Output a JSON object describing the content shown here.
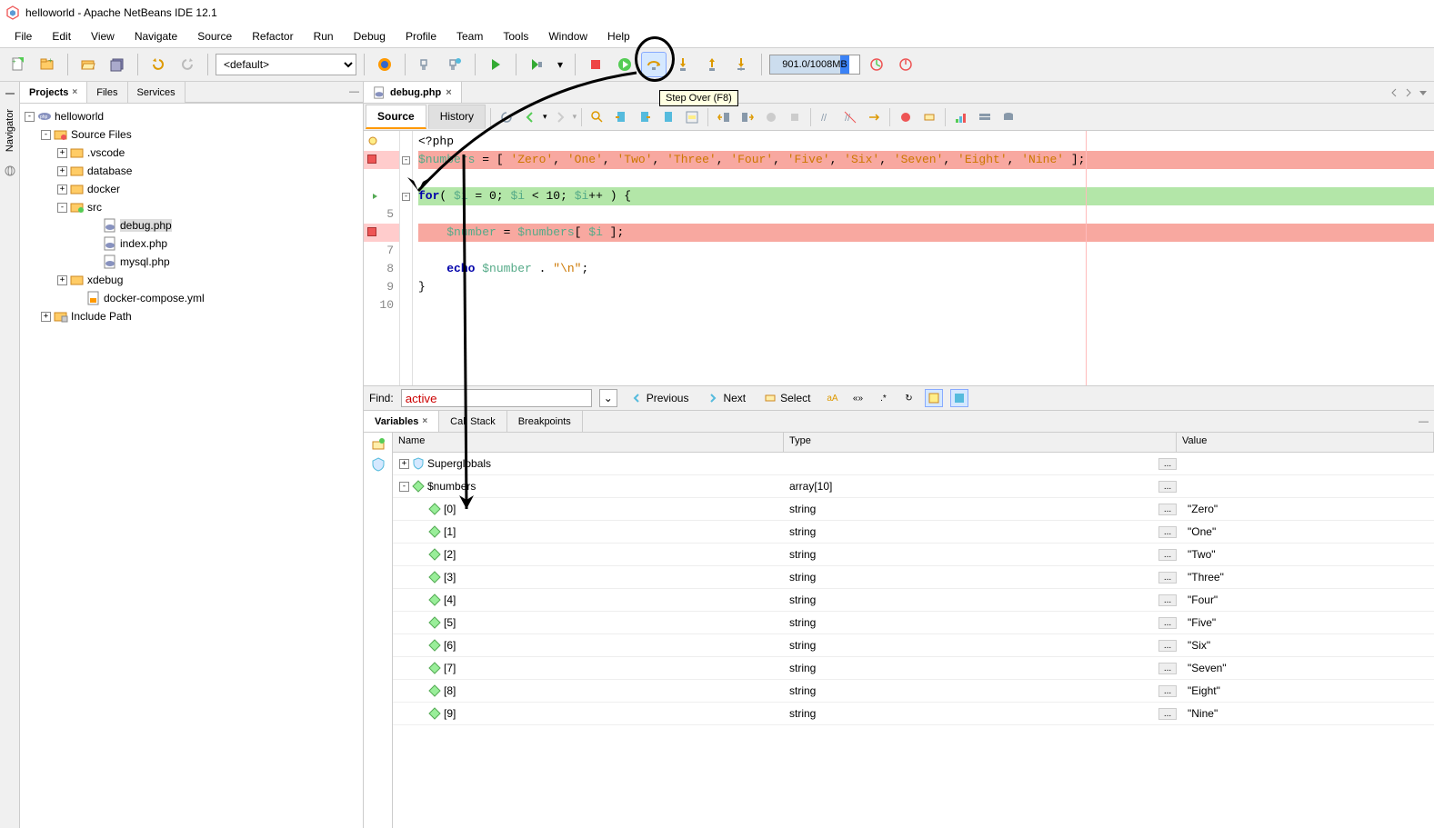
{
  "window": {
    "title": "helloworld - Apache NetBeans IDE 12.1"
  },
  "menu": [
    "File",
    "Edit",
    "View",
    "Navigate",
    "Source",
    "Refactor",
    "Run",
    "Debug",
    "Profile",
    "Team",
    "Tools",
    "Window",
    "Help"
  ],
  "toolbar": {
    "config_select": "<default>",
    "memory": "901.0/1008MB",
    "tooltip": "Step Over (F8)"
  },
  "side_tab": {
    "label": "Navigator"
  },
  "left_panel": {
    "tabs": {
      "projects": "Projects",
      "files": "Files",
      "services": "Services"
    },
    "tree": {
      "root": "helloworld",
      "source_files": "Source Files",
      "vscode": ".vscode",
      "database": "database",
      "docker": "docker",
      "src": "src",
      "debug_php": "debug.php",
      "index_php": "index.php",
      "mysql_php": "mysql.php",
      "xdebug": "xdebug",
      "docker_compose": "docker-compose.yml",
      "include_path": "Include Path"
    }
  },
  "editor": {
    "tab_label": "debug.php",
    "subtabs": {
      "source": "Source",
      "history": "History"
    },
    "code": {
      "l1": "<?php",
      "l2": "$numbers = [ 'Zero', 'One', 'Two', 'Three', 'Four', 'Five', 'Six', 'Seven', 'Eight', 'Nine' ];",
      "l4a": "for( ",
      "l4b": "$i",
      "l4c": " = ",
      "l4d": "0",
      "l4e": "; ",
      "l4f": "$i",
      "l4g": " < ",
      "l4h": "10",
      "l4i": "; ",
      "l4j": "$i++",
      "l4k": " ) {",
      "l6": "    $number = $numbers[ $i ];",
      "l8a": "    echo ",
      "l8b": "$number",
      "l8c": " . ",
      "l8d": "\"\\n\"",
      "l8e": ";",
      "l9": "}"
    }
  },
  "findbar": {
    "label": "Find:",
    "value": "active",
    "previous": "Previous",
    "next": "Next",
    "select": "Select"
  },
  "debug": {
    "tabs": {
      "variables": "Variables",
      "callstack": "Call Stack",
      "breakpoints": "Breakpoints"
    },
    "columns": {
      "name": "Name",
      "type": "Type",
      "value": "Value"
    },
    "rows": [
      {
        "indent": 0,
        "expander": "+",
        "icon": "shield",
        "name": "Superglobals",
        "type": "",
        "value": "",
        "dots": true
      },
      {
        "indent": 0,
        "expander": "-",
        "icon": "diamond",
        "name": "$numbers",
        "type": "array[10]",
        "value": "",
        "dots": true
      },
      {
        "indent": 1,
        "expander": "",
        "icon": "diamond",
        "name": "[0]",
        "type": "string",
        "value": "\"Zero\"",
        "dots": true
      },
      {
        "indent": 1,
        "expander": "",
        "icon": "diamond",
        "name": "[1]",
        "type": "string",
        "value": "\"One\"",
        "dots": true
      },
      {
        "indent": 1,
        "expander": "",
        "icon": "diamond",
        "name": "[2]",
        "type": "string",
        "value": "\"Two\"",
        "dots": true
      },
      {
        "indent": 1,
        "expander": "",
        "icon": "diamond",
        "name": "[3]",
        "type": "string",
        "value": "\"Three\"",
        "dots": true
      },
      {
        "indent": 1,
        "expander": "",
        "icon": "diamond",
        "name": "[4]",
        "type": "string",
        "value": "\"Four\"",
        "dots": true
      },
      {
        "indent": 1,
        "expander": "",
        "icon": "diamond",
        "name": "[5]",
        "type": "string",
        "value": "\"Five\"",
        "dots": true
      },
      {
        "indent": 1,
        "expander": "",
        "icon": "diamond",
        "name": "[6]",
        "type": "string",
        "value": "\"Six\"",
        "dots": true
      },
      {
        "indent": 1,
        "expander": "",
        "icon": "diamond",
        "name": "[7]",
        "type": "string",
        "value": "\"Seven\"",
        "dots": true
      },
      {
        "indent": 1,
        "expander": "",
        "icon": "diamond",
        "name": "[8]",
        "type": "string",
        "value": "\"Eight\"",
        "dots": true
      },
      {
        "indent": 1,
        "expander": "",
        "icon": "diamond",
        "name": "[9]",
        "type": "string",
        "value": "\"Nine\"",
        "dots": true
      }
    ]
  }
}
